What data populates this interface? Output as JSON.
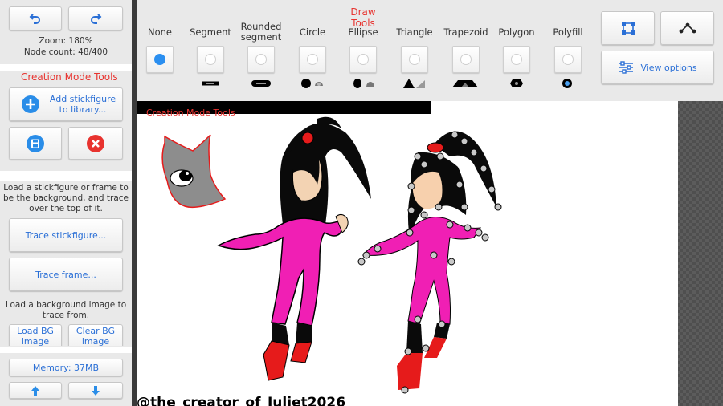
{
  "left_panel": {
    "zoom_text": "Zoom: 180%",
    "node_count_text": "Node count: 48/400",
    "creation_title": "Creation Mode Tools",
    "add_stickfigure_label": "Add stickfigure to library...",
    "trace_help": "Load a stickfigure or frame to be the background, and trace over the top of it.",
    "trace_stickfigure_label": "Trace stickfigure...",
    "trace_frame_label": "Trace frame...",
    "bg_help": "Load a background image to trace from.",
    "load_bg_label": "Load BG image",
    "clear_bg_label": "Clear BG image",
    "memory_label": "Memory: 37MB"
  },
  "draw_tools": {
    "title": "Draw Tools",
    "selected": "None",
    "tools": [
      {
        "name": "None"
      },
      {
        "name": "Segment"
      },
      {
        "name": "Rounded segment"
      },
      {
        "name": "Circle"
      },
      {
        "name": "Ellipse"
      },
      {
        "name": "Triangle"
      },
      {
        "name": "Trapezoid"
      },
      {
        "name": "Polygon"
      },
      {
        "name": "Polyfill"
      }
    ]
  },
  "right_tools": {
    "view_options_label": "View options"
  },
  "canvas": {
    "overlay_title": "Creation Mode Tools",
    "watermark": "@the_creator_of_Juliet2026"
  },
  "colors": {
    "accent": "#2a6fd6",
    "red_label": "#e8332f",
    "radio_selected": "#2b8ff0",
    "figure_pink": "#f01fb4",
    "figure_red": "#e61b1b",
    "hair_black": "#0a0a0a"
  }
}
